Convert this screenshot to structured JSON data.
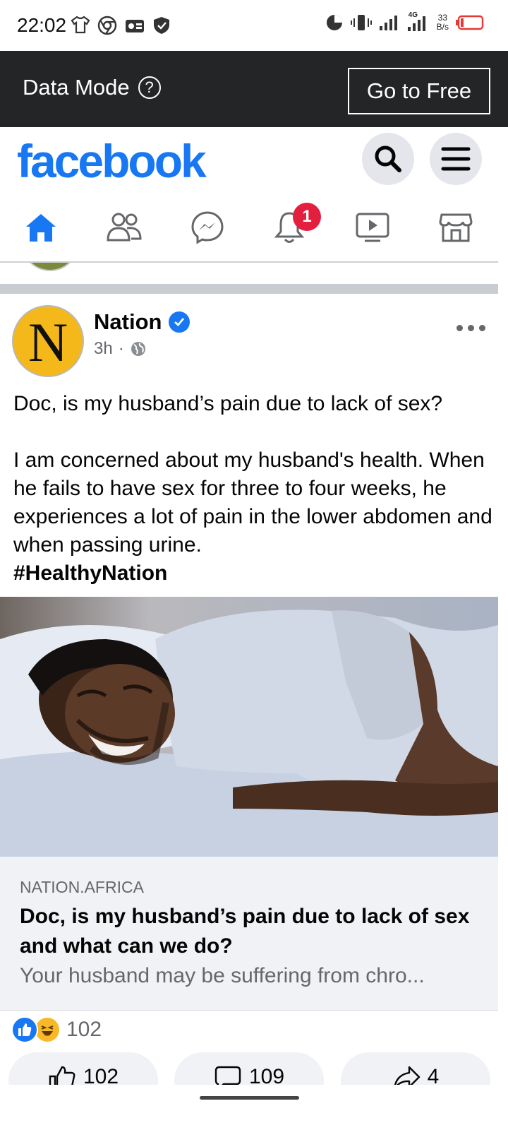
{
  "status_bar": {
    "time": "22:02",
    "network": "4G",
    "speed_value": "33",
    "speed_unit": "B/s",
    "icons": [
      "tshirt-icon",
      "chrome-icon",
      "radio-icon",
      "shield-icon",
      "data-saver-icon",
      "vibrate-icon",
      "signal-icon",
      "signal-4g-icon",
      "battery-low-icon"
    ]
  },
  "data_mode": {
    "label": "Data Mode",
    "help_glyph": "?",
    "button_label": "Go to Free"
  },
  "header": {
    "logo": "facebook",
    "brand_color": "#1877f2"
  },
  "nav": {
    "items": [
      "home-icon",
      "friends-icon",
      "messenger-icon",
      "notifications-icon",
      "watch-icon",
      "marketplace-icon"
    ],
    "active": "home",
    "notification_badge": "1"
  },
  "post": {
    "avatar_letter": "N",
    "page_name": "Nation",
    "time": "3h",
    "separator": "·",
    "text_title": "Doc, is my husband’s pain due to lack of sex?",
    "text_body": "I am concerned about my husband's health. When he fails to have sex for three to four weeks, he experiences a lot of pain in the lower abdomen and when passing urine.",
    "hashtag": "#HealthyNation",
    "link": {
      "domain": "NATION.AFRICA",
      "title": "Doc, is my husband’s pain due to lack of sex and what can we do?",
      "description": "Your husband may be suffering from chro..."
    },
    "reactions": {
      "types": [
        "like",
        "haha"
      ],
      "count": "102"
    },
    "actions": {
      "like_count": "102",
      "comment_count": "109",
      "share_count": "4"
    }
  }
}
